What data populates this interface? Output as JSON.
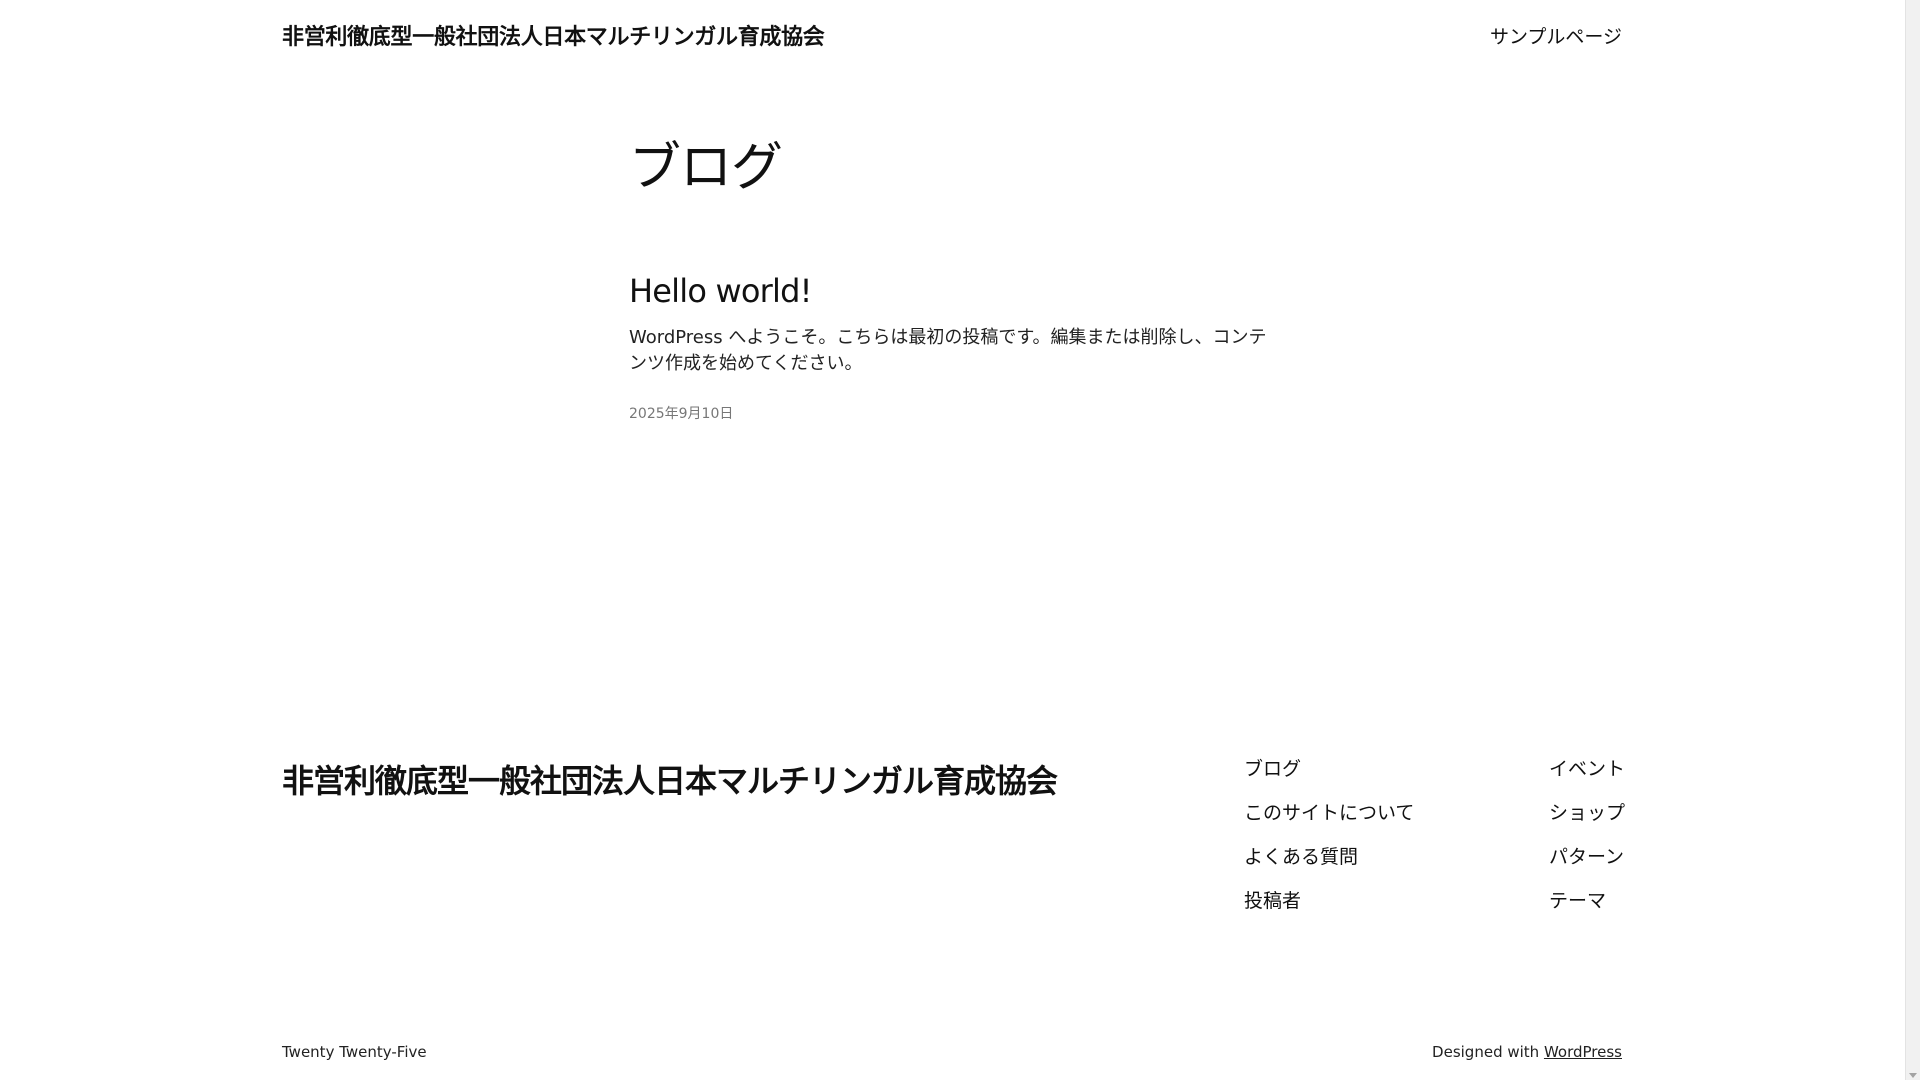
{
  "header": {
    "site_title": "非営利徹底型一般社団法人日本マルチリンガル育成協会",
    "nav": [
      {
        "label": "サンプルページ"
      }
    ]
  },
  "main": {
    "heading": "ブログ",
    "posts": [
      {
        "title": "Hello world!",
        "excerpt": "WordPress へようこそ。こちらは最初の投稿です。編集または削除し、コンテンツ作成を始めてください。",
        "date": "2025年9月10日"
      }
    ]
  },
  "footer": {
    "site_title": "非営利徹底型一般社団法人日本マルチリンガル育成協会",
    "nav_col1": [
      {
        "label": "ブログ"
      },
      {
        "label": "このサイトについて"
      },
      {
        "label": "よくある質問"
      },
      {
        "label": "投稿者"
      }
    ],
    "nav_col2": [
      {
        "label": "イベント"
      },
      {
        "label": "ショップ"
      },
      {
        "label": "パターン"
      },
      {
        "label": "テーマ"
      }
    ],
    "credit_left": "Twenty Twenty-Five",
    "credit_right_prefix": "Designed with ",
    "credit_right_link": "WordPress"
  },
  "icons": {
    "scrollbar_arrow": "chevron-down-icon"
  }
}
